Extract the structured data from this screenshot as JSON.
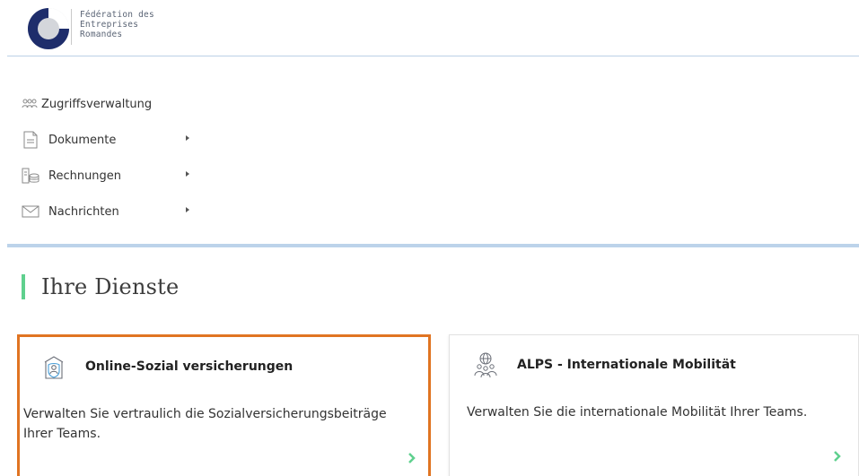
{
  "header": {
    "logo_text": "Fédération des\nEntreprises\nRomandes",
    "logo_icon": "fer-logo-icon"
  },
  "nav": {
    "items": [
      {
        "label": "Zugriffsverwaltung",
        "icon": "users-icon",
        "has_submenu": false
      },
      {
        "label": "Dokumente",
        "icon": "document-icon",
        "has_submenu": true
      },
      {
        "label": "Rechnungen",
        "icon": "invoice-icon",
        "has_submenu": true
      },
      {
        "label": "Nachrichten",
        "icon": "envelope-icon",
        "has_submenu": true
      }
    ]
  },
  "services": {
    "title": "Ihre Dienste",
    "cards": [
      {
        "title": "Online-Sozial versicherungen",
        "description": "Verwalten Sie vertraulich die Sozialversicherungsbeiträge Ihrer Teams.",
        "icon": "insurance-shield-icon",
        "selected": true
      },
      {
        "title": "ALPS - Internationale Mobilität",
        "description": "Verwalten Sie die internationale Mobilität Ihrer Teams.",
        "icon": "globe-people-icon",
        "selected": false
      }
    ]
  },
  "colors": {
    "accent_green": "#5fd08e",
    "selected_border": "#e07422",
    "divider_blue": "#bcd3ea",
    "logo_navy": "#1e2d6b"
  }
}
